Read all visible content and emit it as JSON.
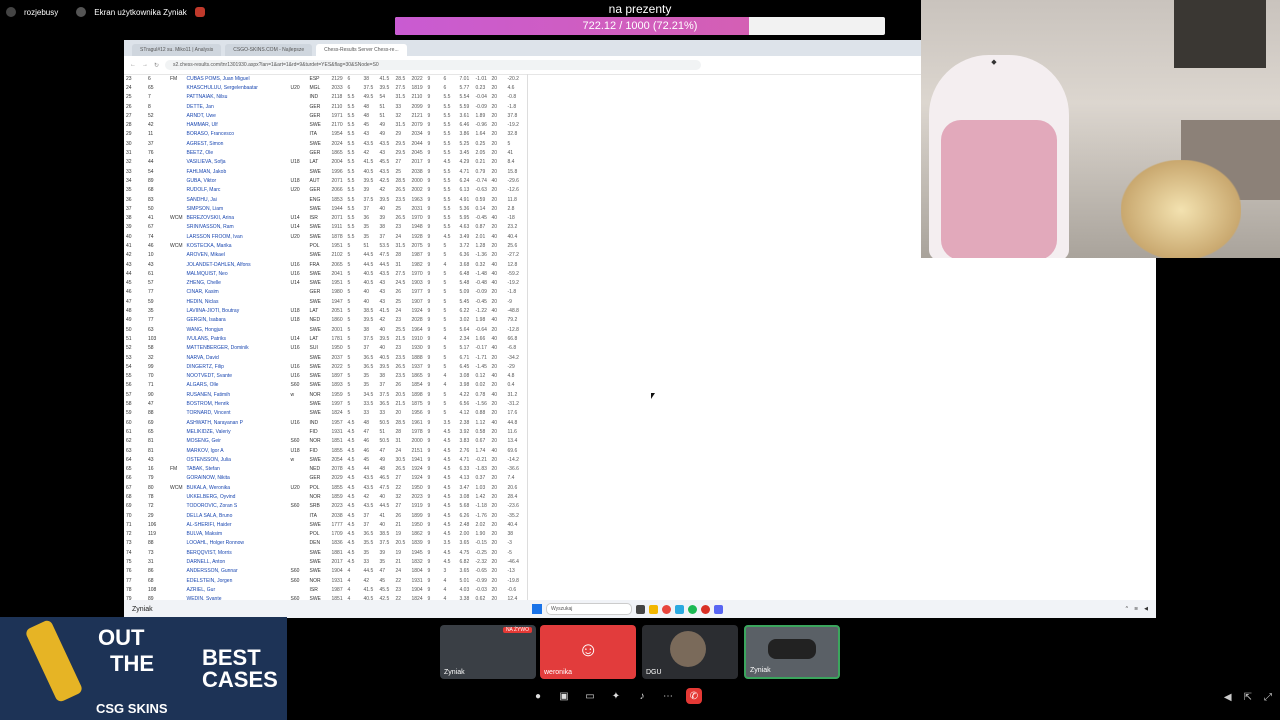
{
  "top_left": {
    "user1": "rozjebusy",
    "user2": "Ekran użytkownika Zyniak"
  },
  "goal": {
    "title": "na prezenty",
    "progress_text": "722.12 / 1000 (72.21%)",
    "progress": 0.7221
  },
  "browser": {
    "tabs": [
      "STragul#12 su. Miko11 | Analysis",
      "CSGO-SKINS.COM - Najlepsze",
      "Chess-Results Server Chess-re..."
    ],
    "url": "s2.chess-results.com/tnr1301930.aspx?lan=1&art=1&rd=9&turdet=YES&flag=30&SNode=S0"
  },
  "table": {
    "rows": [
      [
        "23",
        "6",
        "FM",
        "CUBAS POMS, Juan Miguel",
        "",
        "ESP",
        "2129",
        "6",
        "38",
        "41.5",
        "28.5",
        "2022",
        "9",
        "6",
        "7.01",
        "-1.01",
        "20",
        "-20.2"
      ],
      [
        "24",
        "65",
        "",
        "KHASCHULUU, Sergelenbaatar",
        "U20",
        "MGL",
        "2033",
        "6",
        "37.5",
        "39.5",
        "27.5",
        "1819",
        "9",
        "6",
        "5.77",
        "0.23",
        "20",
        "4.6"
      ],
      [
        "25",
        "7",
        "",
        "PATTNAIAK, Nilsu",
        "",
        "IND",
        "2118",
        "5.5",
        "49.5",
        "54",
        "31.5",
        "2110",
        "9",
        "5.5",
        "5.54",
        "-0.04",
        "20",
        "-0.8"
      ],
      [
        "26",
        "8",
        "",
        "DETTE, Jan",
        "",
        "GER",
        "2110",
        "5.5",
        "48",
        "51",
        "33",
        "2099",
        "9",
        "5.5",
        "5.59",
        "-0.09",
        "20",
        "-1.8"
      ],
      [
        "27",
        "52",
        "",
        "ARNDT, Uwe",
        "",
        "GER",
        "1971",
        "5.5",
        "48",
        "51",
        "32",
        "2121",
        "9",
        "5.5",
        "3.61",
        "1.89",
        "20",
        "37.8"
      ],
      [
        "28",
        "42",
        "",
        "HAMMAR, Ulf",
        "",
        "SWE",
        "2170",
        "5.5",
        "45",
        "49",
        "31.5",
        "2079",
        "9",
        "5.5",
        "6.46",
        "-0.96",
        "20",
        "-19.2"
      ],
      [
        "29",
        "11",
        "",
        "BORASO, Francesco",
        "",
        "ITA",
        "1954",
        "5.5",
        "43",
        "49",
        "29",
        "2034",
        "9",
        "5.5",
        "3.86",
        "1.64",
        "20",
        "32.8"
      ],
      [
        "30",
        "37",
        "",
        "AGREST, Simon",
        "",
        "SWE",
        "2024",
        "5.5",
        "43.5",
        "43.5",
        "29.5",
        "2044",
        "9",
        "5.5",
        "5.25",
        "0.25",
        "20",
        "5"
      ],
      [
        "31",
        "76",
        "",
        "BEETZ, Ole",
        "",
        "GER",
        "1865",
        "5.5",
        "42",
        "43",
        "29.5",
        "2045",
        "9",
        "5.5",
        "3.45",
        "2.05",
        "20",
        "41"
      ],
      [
        "32",
        "44",
        "",
        "VASILIEVA, Sofja",
        "U18",
        "LAT",
        "2004",
        "5.5",
        "41.5",
        "45.5",
        "27",
        "2017",
        "9",
        "4.5",
        "4.29",
        "0.21",
        "20",
        "8.4"
      ],
      [
        "33",
        "54",
        "",
        "FAHLMAN, Jakob",
        "",
        "SWE",
        "1996",
        "5.5",
        "40.5",
        "43.5",
        "25",
        "2038",
        "9",
        "5.5",
        "4.71",
        "0.79",
        "20",
        "15.8"
      ],
      [
        "34",
        "89",
        "",
        "GUBA, Viktor",
        "U18",
        "AUT",
        "2071",
        "5.5",
        "39.5",
        "42.5",
        "28.5",
        "2000",
        "9",
        "5.5",
        "6.24",
        "-0.74",
        "40",
        "-29.6"
      ],
      [
        "35",
        "68",
        "",
        "RUDOLF, Marc",
        "U20",
        "GER",
        "2066",
        "5.5",
        "39",
        "42",
        "26.5",
        "2002",
        "9",
        "5.5",
        "6.13",
        "-0.63",
        "20",
        "-12.6"
      ],
      [
        "36",
        "83",
        "",
        "SANDHU, Jai",
        "",
        "ENG",
        "1853",
        "5.5",
        "37.5",
        "39.5",
        "23.5",
        "1963",
        "9",
        "5.5",
        "4.91",
        "0.59",
        "20",
        "11.8"
      ],
      [
        "37",
        "50",
        "",
        "SIMPSON, Liam",
        "",
        "SWE",
        "1944",
        "5.5",
        "37",
        "40",
        "25",
        "2031",
        "9",
        "5.5",
        "5.36",
        "0.14",
        "20",
        "2.8"
      ],
      [
        "38",
        "41",
        "WCM",
        "BEREZOVSKII, Arina",
        "U14",
        "ISR",
        "2071",
        "5.5",
        "36",
        "39",
        "26.5",
        "1970",
        "9",
        "5.5",
        "5.95",
        "-0.45",
        "40",
        "-18"
      ],
      [
        "39",
        "67",
        "",
        "SRINIVASSON, Ram",
        "U14",
        "SWE",
        "1911",
        "5.5",
        "35",
        "38",
        "23",
        "1948",
        "9",
        "5.5",
        "4.63",
        "0.87",
        "20",
        "23.2"
      ],
      [
        "40",
        "74",
        "",
        "LARSSON FROOM, Ivan",
        "U20",
        "SWE",
        "1878",
        "5.5",
        "35",
        "37",
        "24",
        "1928",
        "9",
        "4.5",
        "3.49",
        "2.01",
        "40",
        "40.4"
      ],
      [
        "41",
        "46",
        "WCM",
        "KOSTECKA, Marika",
        "",
        "POL",
        "1951",
        "5",
        "51",
        "53.5",
        "31.5",
        "2075",
        "9",
        "5",
        "3.72",
        "1.28",
        "20",
        "25.6"
      ],
      [
        "42",
        "10",
        "",
        "AROVEN, Mikael",
        "",
        "SWE",
        "2102",
        "5",
        "44.5",
        "47.5",
        "28",
        "1987",
        "9",
        "5",
        "6.36",
        "-1.36",
        "20",
        "-27.2"
      ],
      [
        "43",
        "43",
        "",
        "JOLANDET-DAHLEN, Alfons",
        "U16",
        "FRA",
        "2065",
        "5",
        "44.5",
        "44.5",
        "31",
        "1982",
        "9",
        "4",
        "3.68",
        "0.32",
        "40",
        "12.8"
      ],
      [
        "44",
        "61",
        "",
        "MALMQUIST, Neo",
        "U16",
        "SWE",
        "2041",
        "5",
        "40.5",
        "43.5",
        "27.5",
        "1970",
        "9",
        "5",
        "6.48",
        "-1.48",
        "40",
        "-59.2"
      ],
      [
        "45",
        "57",
        "",
        "ZHENG, Chelle",
        "U14",
        "SWE",
        "1951",
        "5",
        "40.5",
        "43",
        "24.5",
        "1903",
        "9",
        "5",
        "5.48",
        "-0.48",
        "40",
        "-19.2"
      ],
      [
        "46",
        "77",
        "",
        "CINAR, Kasim",
        "",
        "GER",
        "1980",
        "5",
        "40",
        "43",
        "26",
        "1977",
        "9",
        "5",
        "5.09",
        "-0.09",
        "20",
        "-1.8"
      ],
      [
        "47",
        "59",
        "",
        "HEDIN, Niclas",
        "",
        "SWE",
        "1947",
        "5",
        "40",
        "43",
        "25",
        "1907",
        "9",
        "5",
        "5.45",
        "-0.45",
        "20",
        "-9"
      ],
      [
        "48",
        "35",
        "",
        "LAVIINA-JIOTI, Boutray",
        "U18",
        "LAT",
        "2051",
        "5",
        "38.5",
        "41.5",
        "24",
        "1924",
        "9",
        "5",
        "6.22",
        "-1.22",
        "40",
        "-48.8"
      ],
      [
        "49",
        "77",
        "",
        "GERGIN, Isabara",
        "U18",
        "NED",
        "1860",
        "5",
        "39.5",
        "42",
        "23",
        "2028",
        "9",
        "5",
        "3.02",
        "1.98",
        "40",
        "79.2"
      ],
      [
        "50",
        "63",
        "",
        "WANG, Hongjun",
        "",
        "SWE",
        "2001",
        "5",
        "38",
        "40",
        "25.5",
        "1964",
        "9",
        "5",
        "5.64",
        "-0.64",
        "20",
        "-12.8"
      ],
      [
        "51",
        "103",
        "",
        "IVULANS, Patriks",
        "U14",
        "LAT",
        "1781",
        "5",
        "37.5",
        "39.5",
        "21.5",
        "1910",
        "9",
        "4",
        "2.34",
        "1.66",
        "40",
        "66.8"
      ],
      [
        "52",
        "58",
        "",
        "MATTENBERGER, Dominik",
        "U16",
        "SUI",
        "1950",
        "5",
        "37",
        "40",
        "23",
        "1930",
        "9",
        "5",
        "5.17",
        "-0.17",
        "40",
        "-6.8"
      ],
      [
        "53",
        "32",
        "",
        "NARVA, David",
        "",
        "SWE",
        "2037",
        "5",
        "36.5",
        "40.5",
        "23.5",
        "1888",
        "9",
        "5",
        "6.71",
        "-1.71",
        "20",
        "-34.2"
      ],
      [
        "54",
        "99",
        "",
        "DINGERTZ, Filip",
        "U16",
        "SWE",
        "2022",
        "5",
        "36.5",
        "39.5",
        "26.5",
        "1937",
        "9",
        "5",
        "6.45",
        "-1.45",
        "20",
        "-29"
      ],
      [
        "55",
        "70",
        "",
        "NOOTVEDT, Svante",
        "U16",
        "SWE",
        "1897",
        "5",
        "35",
        "38",
        "23.5",
        "1865",
        "9",
        "4",
        "3.08",
        "0.12",
        "40",
        "4.8"
      ],
      [
        "56",
        "71",
        "",
        "ALGARS, Olle",
        "S60",
        "SWE",
        "1893",
        "5",
        "35",
        "37",
        "26",
        "1854",
        "9",
        "4",
        "3.98",
        "0.02",
        "20",
        "0.4"
      ],
      [
        "57",
        "90",
        "",
        "RUSANEN, Fatimih",
        "w",
        "NOR",
        "1959",
        "5",
        "34.5",
        "37.5",
        "20.5",
        "1898",
        "9",
        "5",
        "4.22",
        "0.78",
        "40",
        "31.2"
      ],
      [
        "58",
        "47",
        "",
        "BOSTROM, Henrik",
        "",
        "SWE",
        "1997",
        "5",
        "33.5",
        "36.5",
        "21.5",
        "1875",
        "9",
        "5",
        "6.56",
        "-1.56",
        "20",
        "-31.2"
      ],
      [
        "59",
        "88",
        "",
        "TORNARD, Vincent",
        "",
        "SWE",
        "1824",
        "5",
        "33",
        "33",
        "20",
        "1956",
        "9",
        "5",
        "4.12",
        "0.88",
        "20",
        "17.6"
      ],
      [
        "60",
        "69",
        "",
        "ASHWATH, Narayanan P",
        "U16",
        "IND",
        "1957",
        "4.5",
        "48",
        "50.5",
        "28.5",
        "1961",
        "9",
        "3.5",
        "2.38",
        "1.12",
        "40",
        "44.8"
      ],
      [
        "61",
        "65",
        "",
        "MELIKIDZE, Valeriy",
        "",
        "FID",
        "1931",
        "4.5",
        "47",
        "51",
        "28",
        "1978",
        "9",
        "4.5",
        "3.92",
        "0.58",
        "20",
        "11.6"
      ],
      [
        "62",
        "81",
        "",
        "MOSENG, Geir",
        "S60",
        "NOR",
        "1851",
        "4.5",
        "46",
        "50.5",
        "31",
        "2000",
        "9",
        "4.5",
        "3.83",
        "0.67",
        "20",
        "13.4"
      ],
      [
        "63",
        "81",
        "",
        "MARKOV, Igor A",
        "U18",
        "FID",
        "1855",
        "4.5",
        "46",
        "47",
        "24",
        "2151",
        "9",
        "4.5",
        "2.76",
        "1.74",
        "40",
        "69.6"
      ],
      [
        "64",
        "43",
        "",
        "OSTENSSON, Julia",
        "w",
        "SWE",
        "2054",
        "4.5",
        "45",
        "49",
        "30.5",
        "1941",
        "9",
        "4.5",
        "4.71",
        "-0.21",
        "20",
        "-14.2"
      ],
      [
        "65",
        "16",
        "FM",
        "TABAK, Stefan",
        "",
        "NED",
        "2078",
        "4.5",
        "44",
        "48",
        "26.5",
        "1924",
        "9",
        "4.5",
        "6.33",
        "-1.83",
        "20",
        "-36.6"
      ],
      [
        "66",
        "79",
        "",
        "GORAINOW, Nikita",
        "",
        "GER",
        "2029",
        "4.5",
        "43.5",
        "46.5",
        "27",
        "1924",
        "9",
        "4.5",
        "4.13",
        "0.37",
        "20",
        "7.4"
      ],
      [
        "67",
        "80",
        "WCM",
        "BUKALA, Weronika",
        "U20",
        "POL",
        "1855",
        "4.5",
        "43.5",
        "47.5",
        "22",
        "1950",
        "9",
        "4.5",
        "3.47",
        "1.03",
        "20",
        "20.6"
      ],
      [
        "68",
        "78",
        "",
        "UKKELBERG, Oyvind",
        "",
        "NOR",
        "1859",
        "4.5",
        "42",
        "40",
        "32",
        "2023",
        "9",
        "4.5",
        "3.08",
        "1.42",
        "20",
        "28.4"
      ],
      [
        "69",
        "72",
        "",
        "TODOROVIC, Zoran S",
        "S60",
        "SRB",
        "2023",
        "4.5",
        "43.5",
        "44.5",
        "27",
        "1919",
        "9",
        "4.5",
        "5.68",
        "-1.18",
        "20",
        "-23.6"
      ],
      [
        "70",
        "29",
        "",
        "DELLA SALA, Bruno",
        "",
        "ITA",
        "2038",
        "4.5",
        "37",
        "41",
        "26",
        "1899",
        "9",
        "4.5",
        "6.26",
        "-1.76",
        "20",
        "-35.2"
      ],
      [
        "71",
        "106",
        "",
        "AL-SHERIFI, Haider",
        "",
        "SWE",
        "1777",
        "4.5",
        "37",
        "40",
        "21",
        "1950",
        "9",
        "4.5",
        "2.48",
        "2.02",
        "20",
        "40.4"
      ],
      [
        "72",
        "119",
        "",
        "BULVA, Maksim",
        "",
        "POL",
        "1709",
        "4.5",
        "36.5",
        "38.5",
        "19",
        "1862",
        "9",
        "4.5",
        "2.00",
        "1.90",
        "20",
        "38"
      ],
      [
        "73",
        "88",
        "",
        "LOOAHL, Holger Ronnow",
        "",
        "DEN",
        "1836",
        "4.5",
        "35.5",
        "37.5",
        "20.5",
        "1839",
        "9",
        "3.5",
        "3.65",
        "-0.15",
        "20",
        "-3"
      ],
      [
        "74",
        "73",
        "",
        "BERQQVIST, Morris",
        "",
        "SWE",
        "1881",
        "4.5",
        "35",
        "39",
        "19",
        "1945",
        "9",
        "4.5",
        "4.75",
        "-0.25",
        "20",
        "-5"
      ],
      [
        "75",
        "31",
        "",
        "DARNELL, Anton",
        "",
        "SWE",
        "2017",
        "4.5",
        "33",
        "35",
        "21",
        "1832",
        "9",
        "4.5",
        "6.82",
        "-2.32",
        "20",
        "-46.4"
      ],
      [
        "76",
        "86",
        "",
        "ANDERSSON, Gunnar",
        "S60",
        "SWE",
        "1904",
        "4",
        "44.5",
        "47",
        "24",
        "1804",
        "9",
        "3",
        "3.65",
        "-0.65",
        "20",
        "-13"
      ],
      [
        "77",
        "68",
        "",
        "EDELSTEIN, Jorgen",
        "S60",
        "NOR",
        "1931",
        "4",
        "42",
        "45",
        "22",
        "1931",
        "9",
        "4",
        "5.01",
        "-0.99",
        "20",
        "-19.8"
      ],
      [
        "78",
        "108",
        "",
        "AZRIEL, Gur",
        "",
        "ISR",
        "1987",
        "4",
        "41.5",
        "45.5",
        "23",
        "1904",
        "9",
        "4",
        "4.03",
        "-0.03",
        "20",
        "-0.6"
      ],
      [
        "79",
        "89",
        "",
        "WEDIN, Svante",
        "S60",
        "SWE",
        "1851",
        "4",
        "40.5",
        "42.5",
        "22",
        "1824",
        "9",
        "4",
        "3.38",
        "0.62",
        "20",
        "12.4"
      ]
    ]
  },
  "taskbar": {
    "left_label": "Zyniak",
    "search_placeholder": "Wyszukaj"
  },
  "ad": {
    "line1": "OUT",
    "line2": "THE",
    "line3a": "BEST",
    "line3b": "CASES",
    "brand": "CSG SKINS"
  },
  "tiles": [
    {
      "label": "Zyniak",
      "badge": "NA ŻYWO"
    },
    {
      "label": "weronika"
    },
    {
      "label": "DGU"
    },
    {
      "label": "Zyniak"
    }
  ]
}
